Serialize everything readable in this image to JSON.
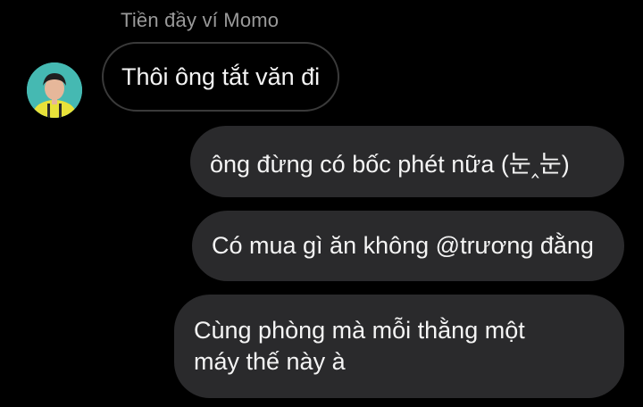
{
  "reply": {
    "label": "Tiền đầy ví Momo"
  },
  "messages": [
    {
      "sender": "other",
      "text": "Thôi ông tắt văn đi"
    },
    {
      "sender": "me",
      "text": "ông đừng có bốc phét nữa (눈‸눈)"
    },
    {
      "sender": "me",
      "text": "Có mua gì ăn không @trương đằng"
    },
    {
      "sender": "me",
      "text": "Cùng phòng mà mỗi thằng một\nmáy thế này à"
    }
  ],
  "colors": {
    "background": "#000000",
    "bubble_me": "#2a2a2c",
    "bubble_other_border": "#3a3a3a",
    "reply_label": "#9a9a9a",
    "text": "#f4f4f4"
  },
  "icons": {
    "avatar": "user-avatar"
  }
}
